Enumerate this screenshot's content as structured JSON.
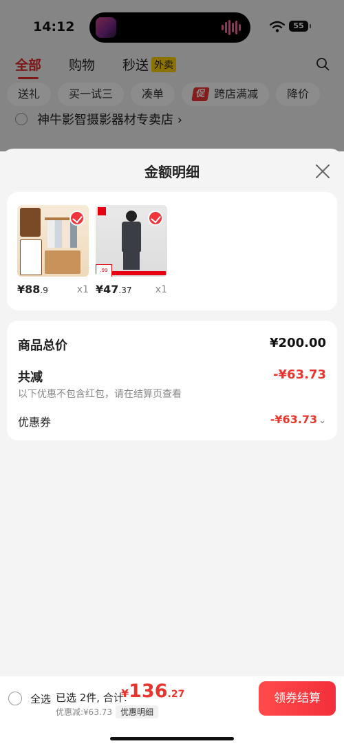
{
  "status": {
    "time": "14:12",
    "battery": "55"
  },
  "tabs": [
    {
      "label": "全部",
      "badge": ""
    },
    {
      "label": "购物",
      "badge": ""
    },
    {
      "label": "秒送",
      "badge": "外卖"
    }
  ],
  "chips": [
    {
      "label": "送礼",
      "icon": ""
    },
    {
      "label": "买一试三",
      "icon": ""
    },
    {
      "label": "凑单",
      "icon": ""
    },
    {
      "label": "跨店满减",
      "icon": "促"
    },
    {
      "label": "降价",
      "icon": ""
    }
  ],
  "shop": {
    "name": "神牛影智摄影器材专卖店 ›"
  },
  "sheet": {
    "title": "金额明细"
  },
  "products": [
    {
      "price_int": "¥88",
      "price_dec": ".9",
      "qty": "x1"
    },
    {
      "price_int": "¥47",
      "price_dec": ".37",
      "qty": "x1"
    }
  ],
  "summary": {
    "total_label": "商品总价",
    "total_value": "¥200.00",
    "minus_label": "共减",
    "minus_value": "-¥63.73",
    "note": "以下优惠不包含红包，请在结算页查看",
    "coupon_label": "优惠券",
    "coupon_value": "-¥63.73"
  },
  "bottom": {
    "select_all": "全选",
    "selected": "已选 2件, 合计:",
    "yen": "¥",
    "amount_int": "136",
    "amount_dec": ".27",
    "discount": "优惠减:¥63.73",
    "detail": "优惠明细",
    "checkout": "领券结算"
  },
  "colors": {
    "accent": "#e8352e",
    "checkout": "#f32f3b",
    "badge_yellow": "#ffd200"
  }
}
